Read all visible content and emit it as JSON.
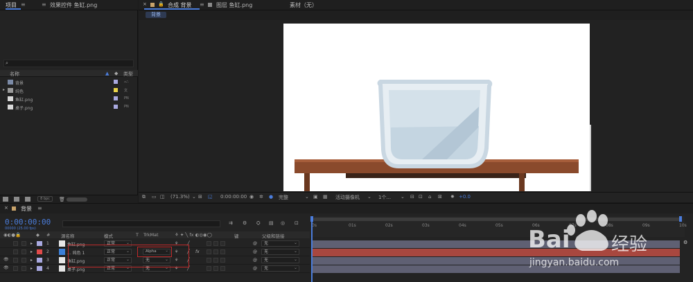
{
  "project_panel": {
    "tab_project": "项目",
    "tab_effects": "效果控件 鱼缸.png",
    "columns": {
      "name": "名称",
      "type": "类型"
    },
    "items": [
      {
        "name": "背景",
        "label_color": "#a9a9e0",
        "type": ""
      },
      {
        "name": "纯色",
        "label_color": "#e8d34a",
        "type": "文"
      },
      {
        "name": "鱼缸.png",
        "label_color": "#a9a9e0",
        "type": "PN"
      },
      {
        "name": "桌子.png",
        "label_color": "#a9a9e0",
        "type": "PN"
      }
    ],
    "bpc": "8 bpc"
  },
  "comp_panel": {
    "tab_comp": "合成 背景",
    "tab_layer": "图层 鱼缸.png",
    "tab_footage": "素材（无）",
    "breadcrumb": "背景",
    "zoom": "(71.3%)",
    "timecode": "0:00:00:00",
    "resolution": "完整",
    "camera": "活动摄像机",
    "views": "1个...",
    "exposure": "+0.0"
  },
  "timeline": {
    "tab": "背景",
    "time": "0:00:00:00",
    "fps": "00000 (25.00 fps)",
    "columns": {
      "num": "#",
      "source": "源名称",
      "mode": "模式",
      "t": "T",
      "trkmat": "TrkMat",
      "key": "键",
      "parent": "父级和链接"
    },
    "ruler": [
      "0s",
      "01s",
      "02s",
      "03s",
      "04s",
      "05s",
      "06s",
      "07s",
      "08s",
      "09s",
      "10s"
    ],
    "layers": [
      {
        "num": "1",
        "name": "鱼缸.png",
        "mode": "正常",
        "trkmat": "",
        "parent": "无",
        "color": "#a9a9e0",
        "bar": "#5f6073"
      },
      {
        "num": "2",
        "name": "... 纯色 1",
        "mode": "正常",
        "trkmat": "Alpha",
        "parent": "无",
        "color": "#e04a4a",
        "bar": "#a8473f"
      },
      {
        "num": "3",
        "name": "鱼缸.png",
        "mode": "正常",
        "trkmat": "无",
        "parent": "无",
        "color": "#a9a9e0",
        "bar": "#5f6073"
      },
      {
        "num": "4",
        "name": "桌子.png",
        "mode": "正常",
        "trkmat": "无",
        "parent": "无",
        "color": "#a9a9e0",
        "bar": "#5f6073"
      }
    ]
  },
  "watermark": {
    "brand_left": "Bai",
    "brand_right": "经验",
    "url": "jingyan.baidu.com"
  }
}
